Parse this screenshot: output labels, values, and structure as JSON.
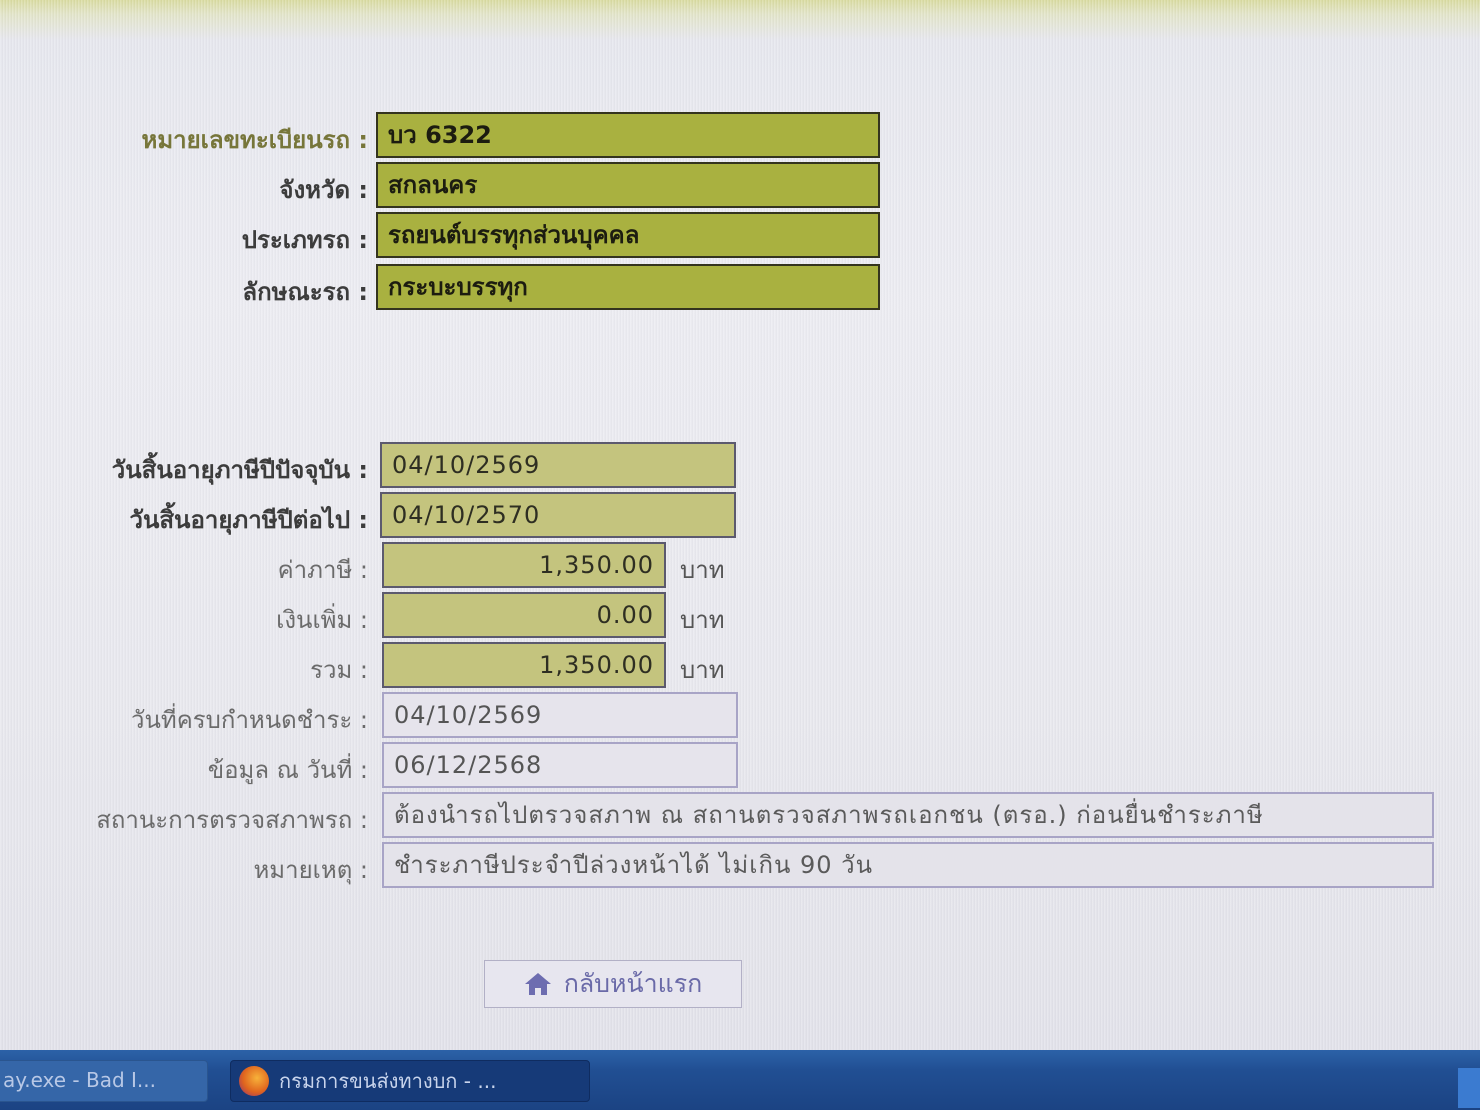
{
  "vehicle": {
    "plate": {
      "label": "หมายเลขทะเบียนรถ :",
      "value": "บว 6322"
    },
    "province": {
      "label": "จังหวัด :",
      "value": "สกลนคร"
    },
    "type": {
      "label": "ประเภทรถ :",
      "value": "รถยนต์บรรทุกส่วนบุคคล"
    },
    "style": {
      "label": "ลักษณะรถ :",
      "value": "กระบะบรรทุก"
    }
  },
  "tax": {
    "current_expiry": {
      "label": "วันสิ้นอายุภาษีปีปัจจุบัน :",
      "value": "04/10/2569"
    },
    "next_expiry": {
      "label": "วันสิ้นอายุภาษีปีต่อไป :",
      "value": "04/10/2570"
    },
    "tax_amount": {
      "label": "ค่าภาษี :",
      "value": "1,350.00",
      "unit": "บาท"
    },
    "surcharge": {
      "label": "เงินเพิ่ม :",
      "value": "0.00",
      "unit": "บาท"
    },
    "total": {
      "label": "รวม :",
      "value": "1,350.00",
      "unit": "บาท"
    },
    "due_date": {
      "label": "วันที่ครบกำหนดชำระ :",
      "value": "04/10/2569"
    },
    "data_as_of": {
      "label": "ข้อมูล ณ วันที่ :",
      "value": "06/12/2568"
    },
    "inspection_status": {
      "label": "สถานะการตรวจสภาพรถ :",
      "value": "ต้องนำรถไปตรวจสภาพ ณ สถานตรวจสภาพรถเอกชน (ตรอ.) ก่อนยื่นชำระภาษี"
    },
    "remark": {
      "label": "หมายเหตุ :",
      "value": "ชำระภาษีประจำปีล่วงหน้าได้ ไม่เกิน 90 วัน"
    }
  },
  "actions": {
    "home_button": "กลับหน้าแรก"
  },
  "taskbar": {
    "inactive_task": "ay.exe - Bad I...",
    "active_task": "กรมการขนส่งทางบก - ..."
  },
  "colors": {
    "green_field": "#a9b140",
    "khaki_field": "#c4c47e",
    "plain_field": "#e6e4ec",
    "taskbar": "#214f93"
  }
}
